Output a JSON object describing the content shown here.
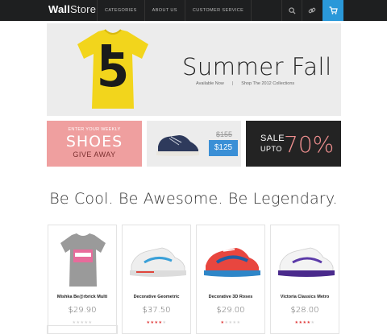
{
  "brand": {
    "name_bold": "Wall",
    "name_light": "Store"
  },
  "nav": {
    "items": [
      "CATEGORIES",
      "ABOUT US",
      "CUSTOMER SERVICE"
    ]
  },
  "hero": {
    "title": "Summer Fall",
    "sub_left": "Available Now",
    "sub_sep": "|",
    "sub_right": "Shop The 2012 Collections",
    "shirt_number": "5"
  },
  "promos": {
    "pink": {
      "line1": "ENTER YOUR WEEKLY",
      "line2": "SHOES",
      "line3": "GIVE AWAY"
    },
    "shoe": {
      "old_price": "$155",
      "new_price": "$125"
    },
    "dark": {
      "sale": "SALE",
      "upto": "UPTO",
      "percent": "70%"
    }
  },
  "tagline": "Be Cool. Be Awesome. Be Legendary.",
  "products": [
    {
      "name": "Mishka Be@rbrick Multi",
      "price": "$29.90",
      "rating": 0
    },
    {
      "name": "Decorative Geometric",
      "price": "$37.50",
      "rating": 4
    },
    {
      "name": "Decorative 3D Roses",
      "price": "$29.00",
      "rating": 1
    },
    {
      "name": "Victoria Classics Metro",
      "price": "$28.00",
      "rating": 4
    }
  ],
  "colors": {
    "accent": "#2a98d9",
    "pink": "#ef9f9f",
    "dark": "#232323",
    "star": "#e03a3a"
  }
}
